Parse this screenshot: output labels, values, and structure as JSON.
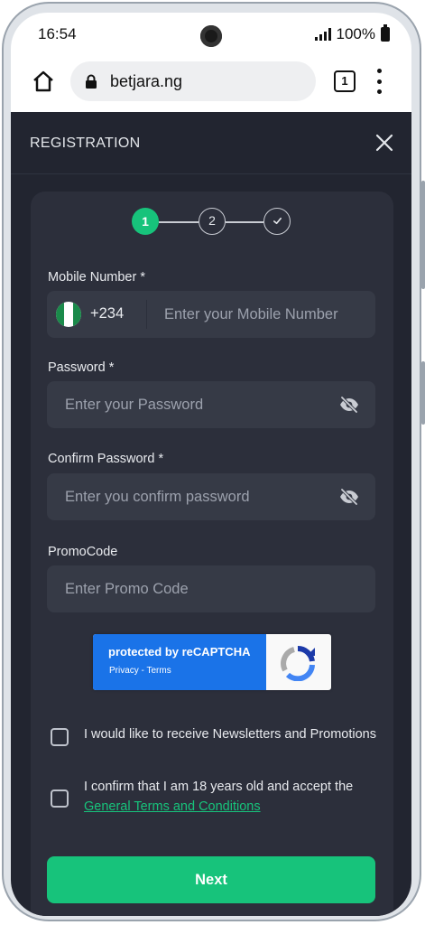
{
  "status_bar": {
    "time": "16:54",
    "battery": "100%"
  },
  "browser": {
    "url": "betjara.ng",
    "tab_count": "1"
  },
  "registration": {
    "title": "REGISTRATION",
    "steps": [
      "1",
      "2"
    ],
    "mobile": {
      "label": "Mobile Number *",
      "country_code": "+234",
      "placeholder": "Enter your Mobile Number"
    },
    "password": {
      "label": "Password *",
      "placeholder": "Enter your Password"
    },
    "confirm_password": {
      "label": "Confirm Password *",
      "placeholder": "Enter you confirm password"
    },
    "promo": {
      "label": "PromoCode",
      "placeholder": "Enter Promo Code"
    },
    "recaptcha": {
      "title": "protected by reCAPTCHA",
      "links": "Privacy - Terms"
    },
    "newsletter_text": "I would like to receive Newsletters and Promotions",
    "terms_text": "I confirm that I am 18 years old and accept the",
    "terms_link": "General Terms and Conditions",
    "next_label": "Next"
  },
  "colors": {
    "accent": "#17c37b",
    "background": "#222530",
    "card": "#2c2f3b",
    "field": "#363a46"
  }
}
